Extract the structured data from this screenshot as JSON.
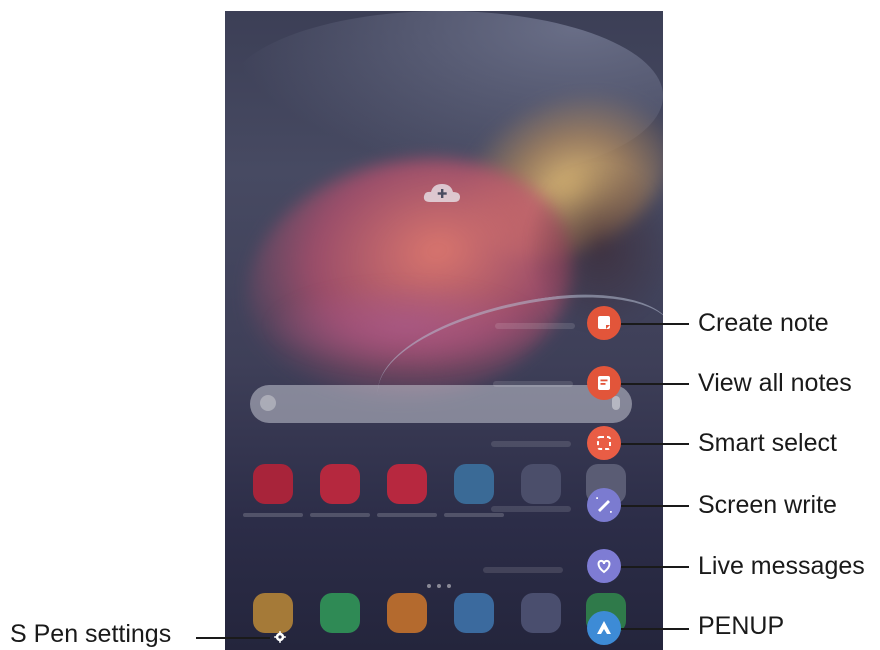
{
  "annotations": {
    "create_note": "Create note",
    "view_all_notes": "View all notes",
    "smart_select": "Smart select",
    "screen_write": "Screen write",
    "live_messages": "Live messages",
    "penup": "PENUP",
    "s_pen_settings": "S Pen settings"
  },
  "colors": {
    "note_orange": "#e2553a",
    "smart_select_orange": "#e95d45",
    "screen_write_purple": "#7b7bd0",
    "live_messages_purple": "#7e7cd4",
    "penup_blue": "#3d8bd6",
    "text": "#1a1a1a"
  },
  "icons": [
    "cloud-add-icon",
    "create-note-icon",
    "view-all-notes-icon",
    "smart-select-icon",
    "screen-write-icon",
    "live-messages-icon",
    "penup-icon",
    "gear-icon"
  ]
}
